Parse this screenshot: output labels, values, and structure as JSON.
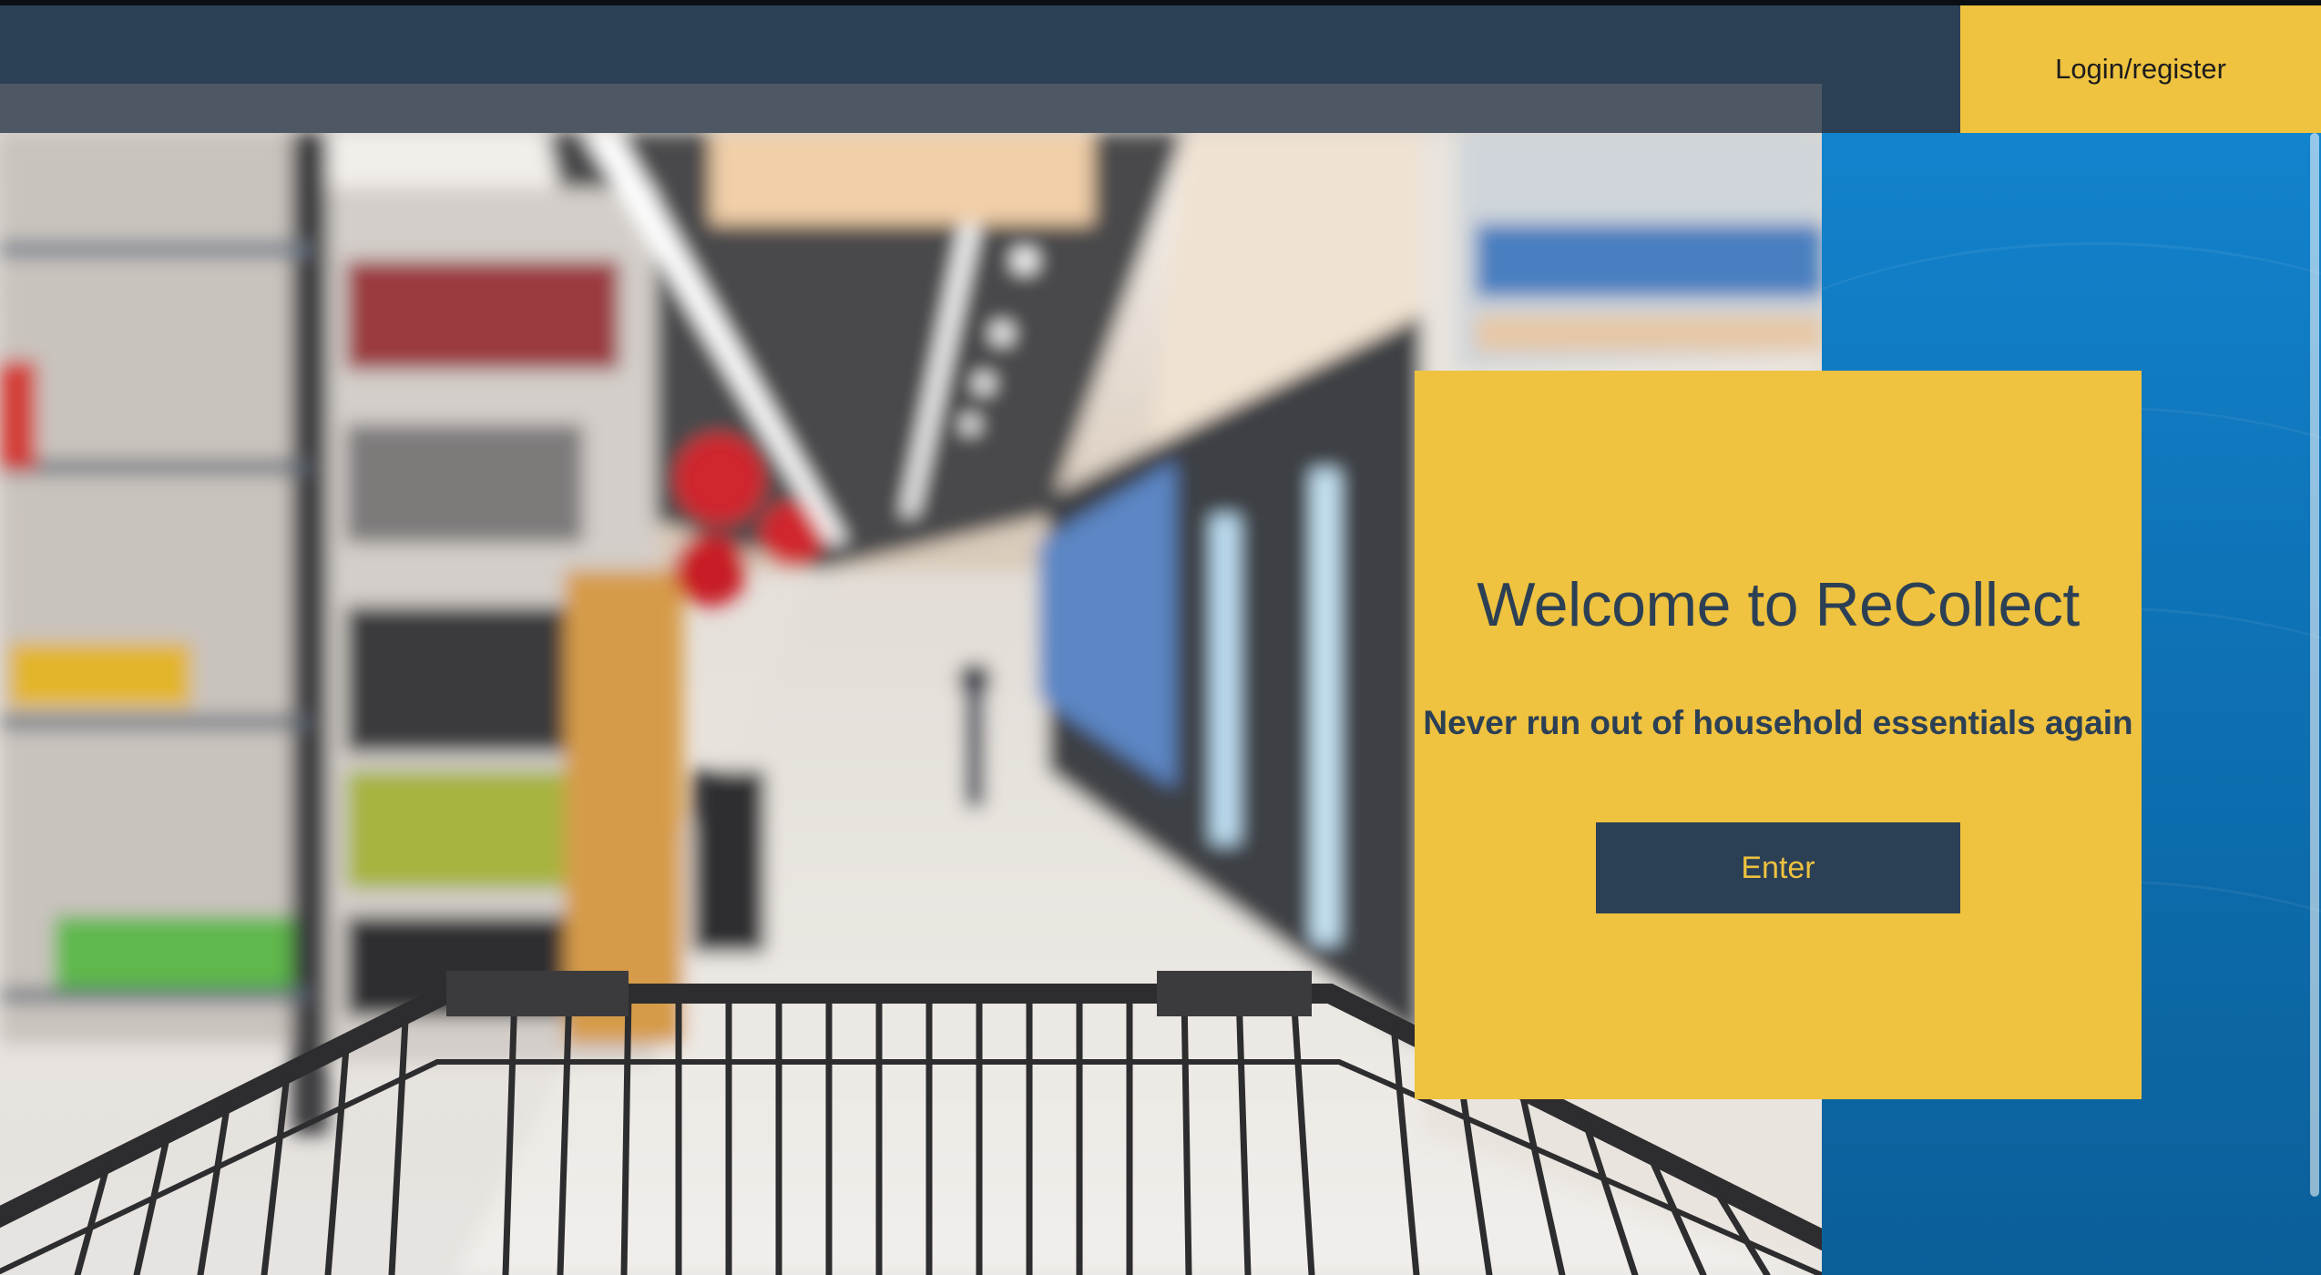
{
  "header": {
    "login_label": "Login/register"
  },
  "hero": {
    "title": "Welcome to ReCollect",
    "subtitle": "Never run out of household essentials again",
    "enter_label": "Enter"
  },
  "colors": {
    "header_bg": "#2c4055",
    "accent_yellow": "#efc23f",
    "panel_blue": "#1283cd"
  }
}
